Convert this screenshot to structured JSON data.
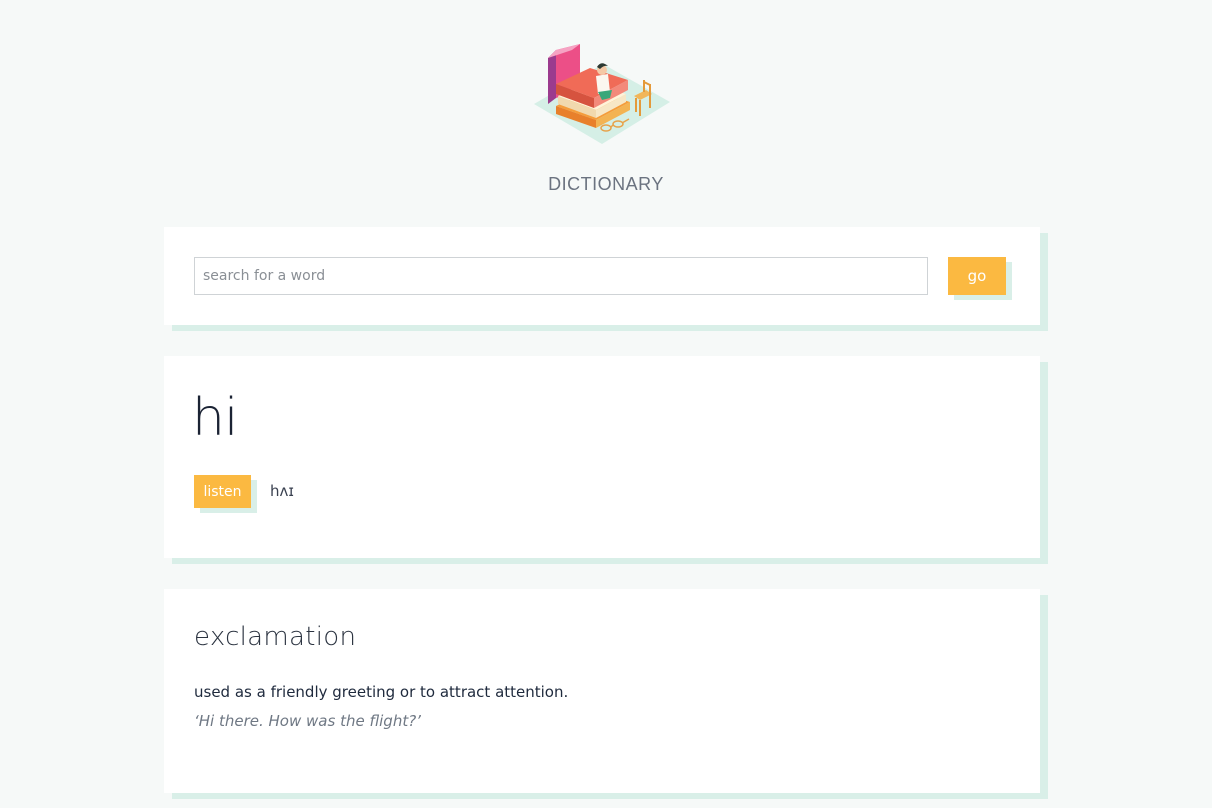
{
  "header": {
    "title": "DICTIONARY",
    "logo_icon": "books-reading-illustration-icon"
  },
  "search": {
    "placeholder": "search for a word",
    "value": "",
    "button_label": "go"
  },
  "entry": {
    "word": "hi",
    "listen_label": "listen",
    "phonetic": "hʌɪ"
  },
  "meanings": [
    {
      "part_of_speech": "exclamation",
      "definition": "used as a friendly greeting or to attract attention.",
      "example": "‘Hi there. How was the flight?’"
    }
  ],
  "colors": {
    "accent": "#fbb941",
    "shadow": "#d9efe8",
    "background": "#f6f9f8"
  }
}
